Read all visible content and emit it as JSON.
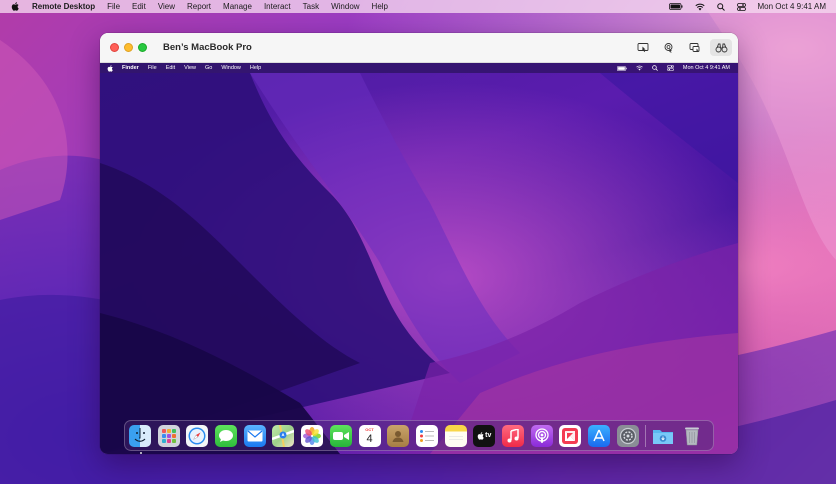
{
  "host_menubar": {
    "app_name": "Remote Desktop",
    "items": [
      "File",
      "Edit",
      "View",
      "Report",
      "Manage",
      "Interact",
      "Task",
      "Window",
      "Help"
    ],
    "clock": "Mon Oct 4  9:41 AM"
  },
  "window": {
    "title": "Ben’s MacBook Pro",
    "toolbar_icons": [
      "control-screen-icon",
      "curtain-icon",
      "share-screen-icon",
      "observe-binoculars-icon"
    ]
  },
  "remote_menubar": {
    "app_name": "Finder",
    "items": [
      "File",
      "Edit",
      "View",
      "Go",
      "Window",
      "Help"
    ],
    "clock": "Mon Oct 4  9:41 AM"
  },
  "dock": {
    "calendar_month": "OCT",
    "calendar_day": "4",
    "tv_label": "tv",
    "apps": [
      "Finder",
      "Launchpad",
      "Safari",
      "Messages",
      "Mail",
      "Maps",
      "Photos",
      "FaceTime",
      "Calendar",
      "Contacts",
      "Reminders",
      "Notes",
      "TV",
      "Music",
      "Podcasts",
      "News",
      "App Store",
      "System Preferences",
      "Downloads",
      "Trash"
    ]
  }
}
